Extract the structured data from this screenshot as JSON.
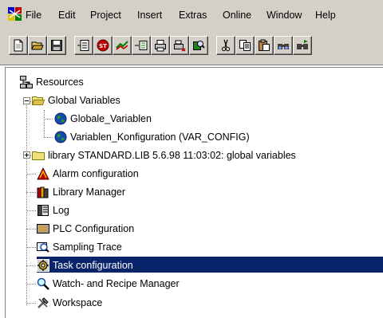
{
  "menu": {
    "items": [
      "File",
      "Edit",
      "Project",
      "Insert",
      "Extras",
      "Online",
      "Window",
      "Help"
    ]
  },
  "toolbar": {
    "buttons": [
      "new-file-icon",
      "open-folder-icon",
      "save-icon",
      "insert-icon",
      "stop-icon",
      "login-icon",
      "variable-icon",
      "print-icon",
      "print-setup-icon",
      "search-icon",
      "cut-icon",
      "copy-icon",
      "paste-icon",
      "find-icon",
      "find-next-icon"
    ]
  },
  "tree": {
    "root": "Resources",
    "global_variables": "Global Variables",
    "globale_variablen": "Globale_Variablen",
    "variablen_konfiguration": "Variablen_Konfiguration (VAR_CONFIG)",
    "library": "library STANDARD.LIB 5.6.98 11:03:02: global variables",
    "alarm_configuration": "Alarm configuration",
    "library_manager": "Library Manager",
    "log": "Log",
    "plc_configuration": "PLC Configuration",
    "sampling_trace": "Sampling Trace",
    "task_configuration": "Task configuration",
    "watch_recipe_manager": "Watch- and Recipe Manager",
    "workspace": "Workspace"
  },
  "colors": {
    "selection": "#0a246a",
    "chrome": "#d4d0c8"
  }
}
